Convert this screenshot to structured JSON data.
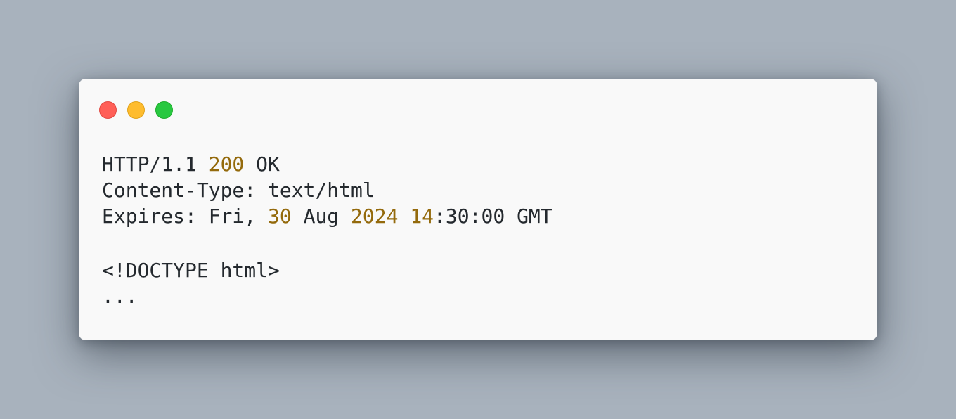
{
  "window": {
    "controls": [
      {
        "name": "close",
        "color": "#ff5f57"
      },
      {
        "name": "minimize",
        "color": "#febc2e"
      },
      {
        "name": "maximize",
        "color": "#28c840"
      }
    ]
  },
  "code": {
    "status_line": {
      "protocol": "HTTP/1.1",
      "status_code": "200",
      "reason": "OK"
    },
    "content_type": {
      "key": "Content-Type:",
      "value": "text/html"
    },
    "expires": {
      "key": "Expires:",
      "weekday": "Fri,",
      "day": "30",
      "month": "Aug",
      "year": "2024",
      "hour": "14",
      "rest_time": ":30:00",
      "zone": "GMT"
    },
    "doctype": "<!DOCTYPE html>",
    "ellipsis": "..."
  },
  "colors": {
    "background": "#a8b2bd",
    "panel": "#f9f9f9",
    "text": "#24292e",
    "number": "#946a0c"
  }
}
